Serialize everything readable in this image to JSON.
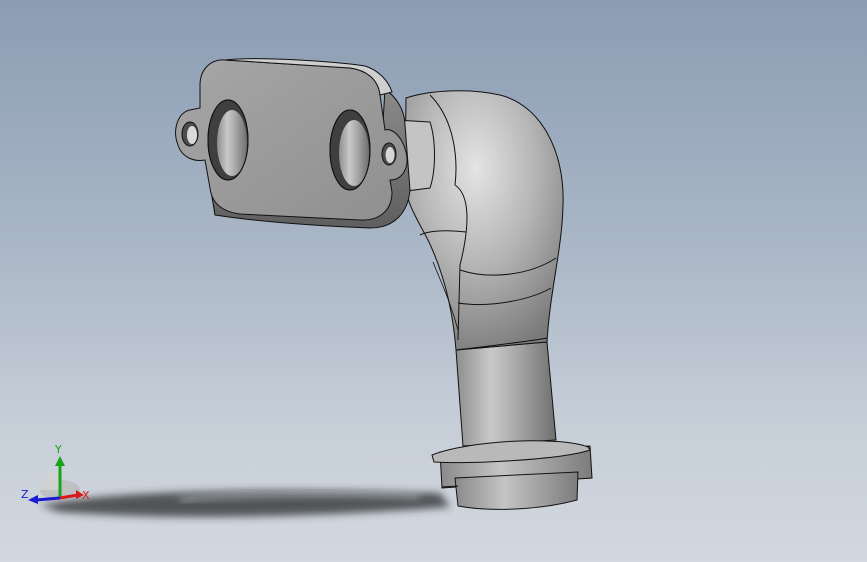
{
  "viewport": {
    "model_name": "",
    "background_top": "#8b9db4",
    "background_bottom": "#d2d8df"
  },
  "model": {
    "body_color": "#a4a4a4",
    "highlight_color": "#d2d2d2",
    "shadow_color": "#6a6a6a",
    "edge_color": "#111111"
  },
  "triad": {
    "x_label": "X",
    "y_label": "Y",
    "z_label": "Z",
    "x_color": "#d81a1a",
    "y_color": "#1aa31a",
    "z_color": "#1a1ad0"
  }
}
